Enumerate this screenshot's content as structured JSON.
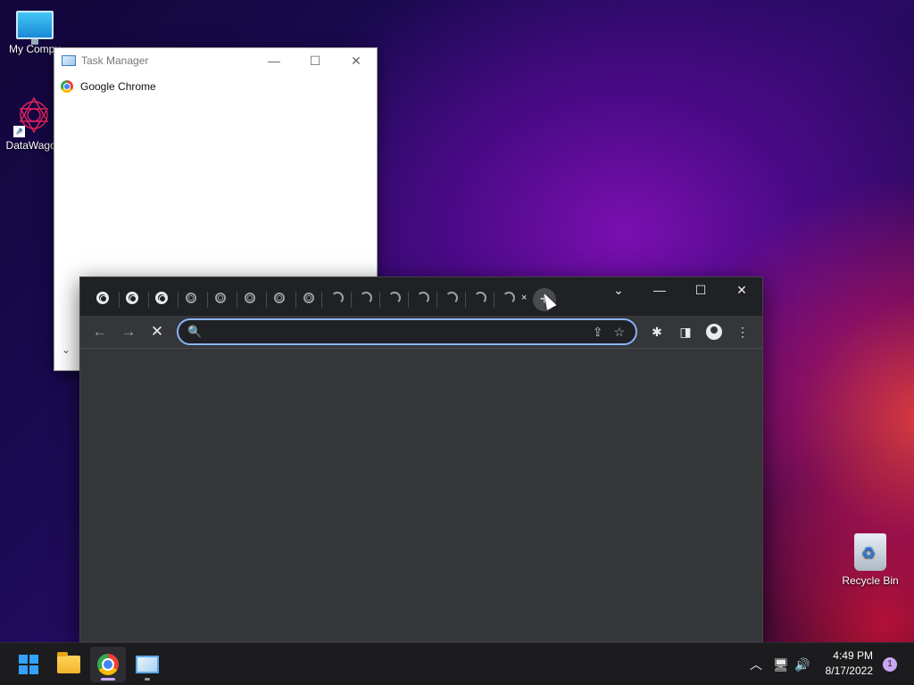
{
  "desktop": {
    "icons": [
      {
        "label": "My Compu"
      },
      {
        "label": "DataWagon"
      },
      {
        "label": "Recycle Bin"
      }
    ]
  },
  "task_manager": {
    "title": "Task Manager",
    "process": "Google Chrome",
    "controls": {
      "minimize": "—",
      "maximize": "☐",
      "close": "✕"
    },
    "more_details": "⌄"
  },
  "chrome": {
    "tab_close": "×",
    "new_tab": "+",
    "tab_search": "⌄",
    "controls": {
      "minimize": "—",
      "maximize": "☐",
      "close": "✕"
    },
    "toolbar": {
      "back": "←",
      "forward": "→",
      "stop": "✕",
      "search_icon": "🔍",
      "address_value": "",
      "share": "⇪",
      "star": "☆",
      "extensions": "✱",
      "side_panel": "◨",
      "menu": "⋮"
    }
  },
  "taskbar": {
    "tray_chevron": "︿",
    "network": "🖥",
    "volume": "🔊",
    "time": "4:49 PM",
    "date": "8/17/2022",
    "notification_count": "1"
  }
}
